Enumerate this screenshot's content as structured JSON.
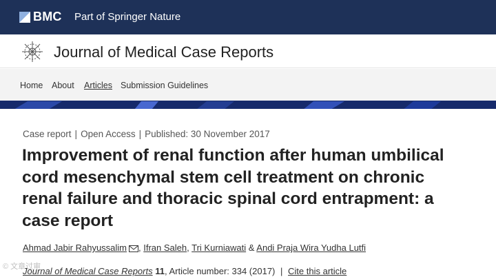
{
  "header": {
    "brand": "BMC",
    "tagline": "Part of Springer Nature"
  },
  "journal": {
    "title": "Journal of Medical Case Reports"
  },
  "nav": {
    "items": [
      "Home",
      "About",
      "Articles",
      "Submission Guidelines"
    ]
  },
  "article": {
    "type": "Case report",
    "access": "Open Access",
    "published": "Published: 30 November 2017",
    "title_lines": [
      "Improvement of renal function after human umbilical",
      "cord mesenchymal stem cell treatment on chronic",
      "renal failure and thoracic spinal cord entrapment: a",
      "case report"
    ],
    "authors": [
      "Ahmad Jabir Rahyussalim",
      "Ifran Saleh",
      "Tri Kurniawati",
      "Andi Praja Wira Yudha Lutfi"
    ],
    "author_sep": ", ",
    "author_and": " & ",
    "citation": {
      "journal": "Journal of Medical Case Reports",
      "volume": "11",
      "article_number": ", Article number: 334 (2017)",
      "cite_link": "Cite this article"
    }
  },
  "watermark": "© 文章过审",
  "colors": {
    "header_bg": "#1e3158",
    "nav_bg": "#f3f3f3",
    "banner": "#162a6b"
  }
}
